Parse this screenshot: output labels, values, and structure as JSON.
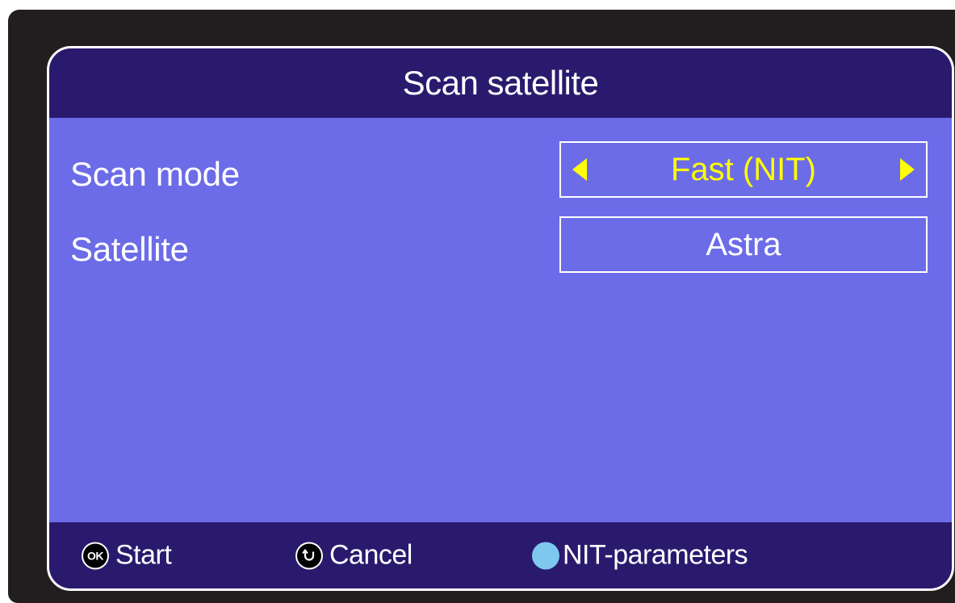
{
  "dialog": {
    "title": "Scan satellite"
  },
  "rows": [
    {
      "label": "Scan mode",
      "value": "Fast (NIT)"
    },
    {
      "label": "Satellite",
      "value": "Astra"
    }
  ],
  "footer": {
    "start": {
      "icon_text": "OK",
      "label": "Start"
    },
    "cancel": {
      "icon": "back-arrow-icon",
      "label": "Cancel"
    },
    "nit": {
      "icon": "blue-button-icon",
      "label": "NIT-parameters"
    }
  },
  "colors": {
    "panel": "#6c6ce8",
    "bar": "#2a1a6e",
    "highlight": "#ffff00",
    "blue_key": "#7ec8ef"
  }
}
